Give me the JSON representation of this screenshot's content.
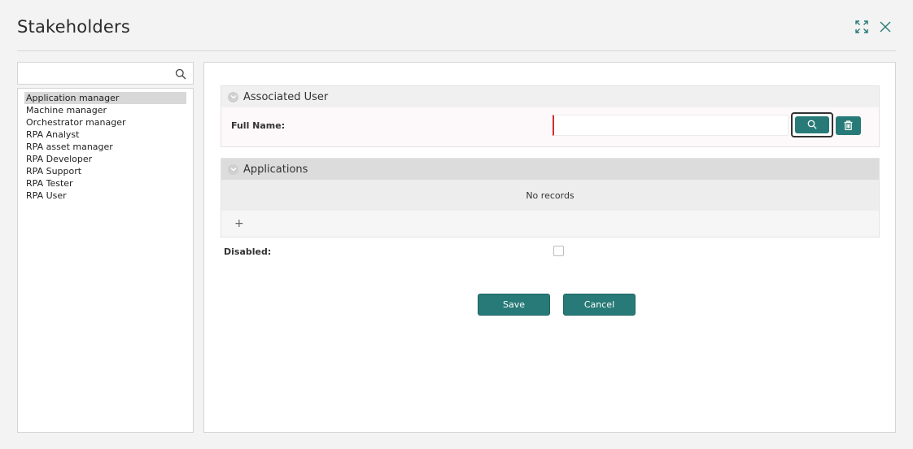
{
  "dialog": {
    "title": "Stakeholders"
  },
  "search": {
    "placeholder": ""
  },
  "roles": [
    {
      "label": "Application manager",
      "selected": true
    },
    {
      "label": "Machine manager"
    },
    {
      "label": "Orchestrator manager"
    },
    {
      "label": "RPA Analyst"
    },
    {
      "label": "RPA asset manager"
    },
    {
      "label": "RPA Developer"
    },
    {
      "label": "RPA Support"
    },
    {
      "label": "RPA Tester"
    },
    {
      "label": "RPA User"
    }
  ],
  "associated_user": {
    "heading": "Associated User",
    "full_name_label": "Full Name:",
    "full_name_value": ""
  },
  "applications": {
    "heading": "Applications",
    "empty_text": "No records",
    "add_label": "+"
  },
  "disabled": {
    "label": "Disabled:",
    "checked": false
  },
  "actions": {
    "save_label": "Save",
    "cancel_label": "Cancel"
  },
  "colors": {
    "accent": "#277a77",
    "required": "#d32f2f"
  },
  "icons": {
    "expand": "expand-icon",
    "close": "close-icon",
    "search": "search-icon",
    "delete": "trash-icon",
    "collapse": "chevron-down-icon"
  }
}
